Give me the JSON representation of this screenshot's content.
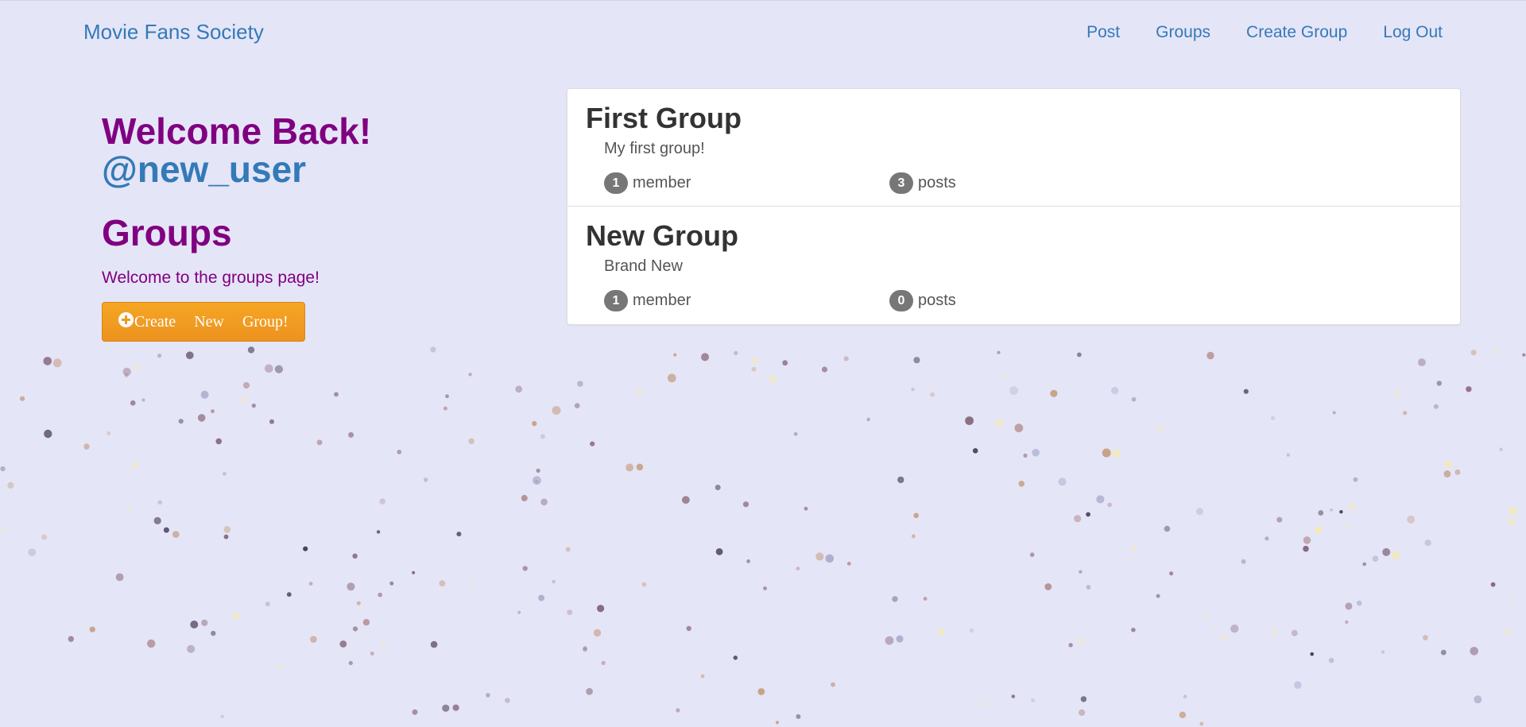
{
  "navbar": {
    "brand": "Movie Fans Society",
    "links": [
      {
        "label": "Post"
      },
      {
        "label": "Groups"
      },
      {
        "label": "Create Group"
      },
      {
        "label": "Log Out"
      }
    ]
  },
  "sidebar": {
    "welcome": "Welcome Back!",
    "username": "@new_user",
    "heading": "Groups",
    "intro": "Welcome to the groups page!",
    "create_button_label": "Create New Group!",
    "create_button_icon": "plus-circle-icon",
    "button_color": "#f0a02a"
  },
  "groups": [
    {
      "name": "First Group",
      "description": "My first group!",
      "member_count": "1",
      "member_label": "member",
      "post_count": "3",
      "post_label": "posts"
    },
    {
      "name": "New Group",
      "description": "Brand New",
      "member_count": "1",
      "member_label": "member",
      "post_count": "0",
      "post_label": "posts"
    }
  ],
  "colors": {
    "background": "#e5e5f8",
    "link": "#337ab7",
    "accent": "#800080",
    "badge": "#777777"
  }
}
